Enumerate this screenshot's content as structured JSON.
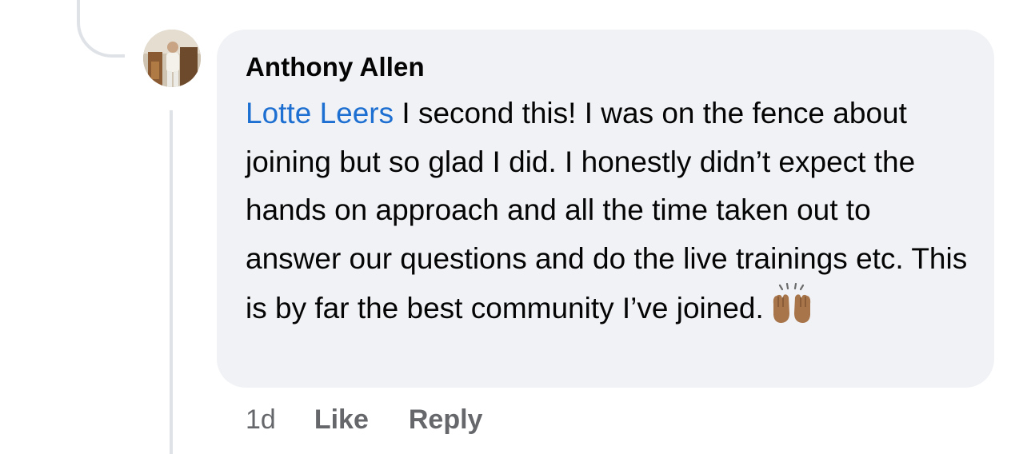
{
  "comment": {
    "author": "Anthony Allen",
    "mention": "Lotte Leers",
    "text": " I second this! I was on the fence about joining but so glad I did. I honestly didn’t expect the hands on approach and all the time taken out to answer our questions and do the live trainings etc. This is by far the best community I’ve joined.",
    "emoji_icon": "raising-hands-emoji",
    "timestamp": "1d",
    "like_label": "Like",
    "reply_label": "Reply"
  },
  "colors": {
    "bubble_background": "#f0f2f5",
    "mention_link": "#1d6fd1",
    "muted_text": "#65676b",
    "thread_line": "#dfe3e8"
  }
}
